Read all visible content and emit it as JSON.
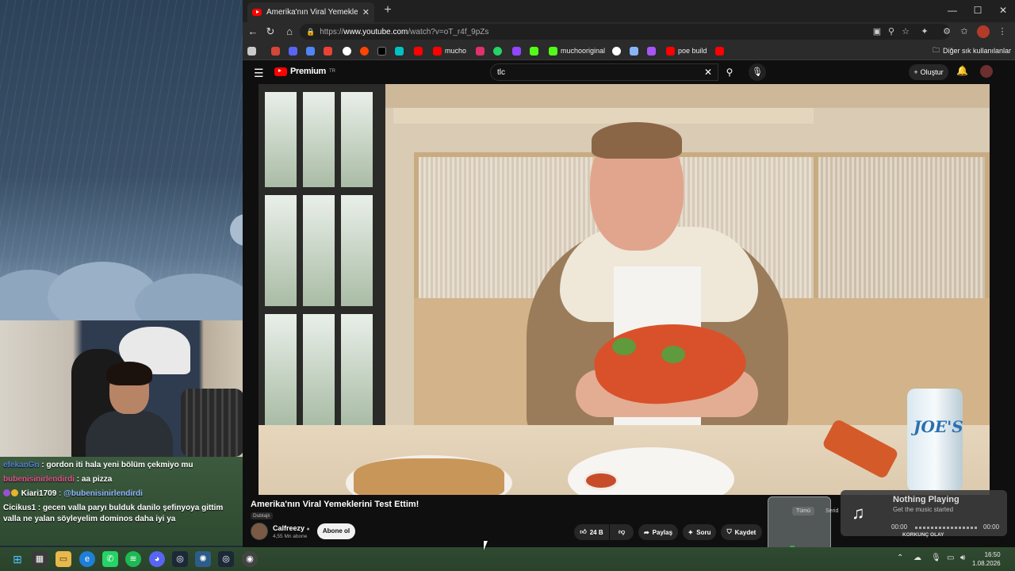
{
  "browser": {
    "tab_title": "Amerika'nın Viral Yemeklerini Test Etti",
    "url_prefix": "https://",
    "url_host": "www.youtube.com",
    "url_path": "/watch?v=oT_r4f_9pZs",
    "bookmarks": [
      {
        "label": "",
        "color": "#c9c9c9"
      },
      {
        "label": "",
        "color": "#d44638"
      },
      {
        "label": "",
        "color": "#5865f2"
      },
      {
        "label": "",
        "color": "#4f86f7"
      },
      {
        "label": "",
        "color": "#ea4335"
      },
      {
        "label": "",
        "color": "#ffffff"
      },
      {
        "label": "",
        "color": "#ff4500"
      },
      {
        "label": "",
        "color": "#000000"
      },
      {
        "label": "",
        "color": "#00c2c2"
      },
      {
        "label": "",
        "color": "#ff0000"
      },
      {
        "label": "mucho",
        "color": "#ff0000"
      },
      {
        "label": "",
        "color": "#e1306c"
      },
      {
        "label": "",
        "color": "#25d366"
      },
      {
        "label": "",
        "color": "#9146ff"
      },
      {
        "label": "",
        "color": "#53fc18"
      },
      {
        "label": "muchooriginal",
        "color": "#53fc18"
      },
      {
        "label": "",
        "color": "#ffffff"
      },
      {
        "label": "",
        "color": "#8ab4f8"
      },
      {
        "label": "",
        "color": "#a855f7"
      },
      {
        "label": "poe build",
        "color": "#ff0000"
      },
      {
        "label": "",
        "color": "#ff0000"
      }
    ],
    "other_bookmarks": "Diğer sık kullanılanlar"
  },
  "youtube": {
    "logo_text": "Premium",
    "logo_sup": "TR",
    "search_value": "tlc",
    "create_label": "Oluştur",
    "video_title": "Amerika'nın Viral Yemeklerini Test Ettim!",
    "dubbed_label": "Dublajlı",
    "channel_name": "Calfreezy",
    "channel_subs": "4,55 Mn abone",
    "subscribe_label": "Abone ol",
    "likes": "24 B",
    "share_label": "Paylaş",
    "ask_label": "Soru",
    "save_label": "Kaydet",
    "can_label": "JOE'S"
  },
  "chat": [
    {
      "user": "efekanGn",
      "user_color": "#4f7fd6",
      "text": " : gordon iti hala yeni bölüm çekmiyo mu",
      "badges": []
    },
    {
      "user": "bubenisinirlendirdi",
      "user_color": "#e0508a",
      "text": " : aa pizza",
      "badges": []
    },
    {
      "user": "Kiari1709",
      "user_color": "#ffffff",
      "text": " : @bubenisinirlendirdi",
      "mention_color": "#8fb7ff",
      "badges": [
        "#9a4fd6",
        "#e9b32a"
      ]
    },
    {
      "user": "Cicikus1",
      "user_color": "#ffffff",
      "text": " : gecen valla paryı bulduk danilo şefinyoya gittim valla ne yalan söyleyelim dominos daha iyi ya",
      "badges": []
    }
  ],
  "overlay": {
    "jar_tag": "Tümü",
    "side_label": "Serid",
    "korkunc": "KORKUNÇ OLAY"
  },
  "music": {
    "title": "Nothing Playing",
    "subtitle": "Get the music started",
    "time_start": "00:00",
    "time_end": "00:00"
  },
  "clock": {
    "time": "16:50",
    "date": "1.08.2026"
  }
}
